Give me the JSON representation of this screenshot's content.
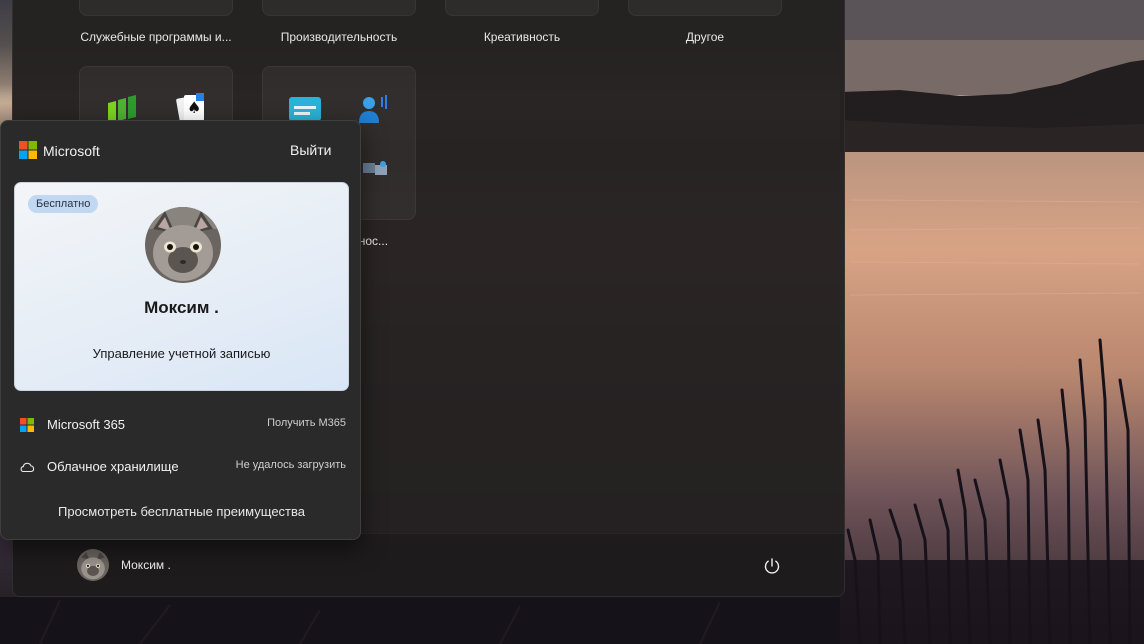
{
  "start_menu": {
    "folders_top": [
      {
        "label": "Служебные программы и..."
      },
      {
        "label": "Производительность"
      },
      {
        "label": "Креативность"
      },
      {
        "label": "Другое"
      }
    ],
    "folder_partial_label": "можнос..."
  },
  "account_flyout": {
    "brand": "Microsoft",
    "sign_out_label": "Выйти",
    "badge": "Бесплатно",
    "user_name": "Моксим .",
    "manage_account_label": "Управление учетной записью",
    "rows": [
      {
        "icon": "microsoft-365-icon",
        "label": "Microsoft 365",
        "action": "Получить M365"
      },
      {
        "icon": "cloud-icon",
        "label": "Облачное хранилище",
        "action": "Не удалось загрузить"
      }
    ],
    "benefits_link": "Просмотреть бесплатные преимущества"
  },
  "user_bar": {
    "user_name": "Моксим .",
    "power_icon": "power-icon"
  },
  "colors": {
    "ms_red": "#f25022",
    "ms_green": "#7fba00",
    "ms_blue": "#00a4ef",
    "ms_yellow": "#ffb900",
    "badge_bg": "#c0d8f2"
  }
}
